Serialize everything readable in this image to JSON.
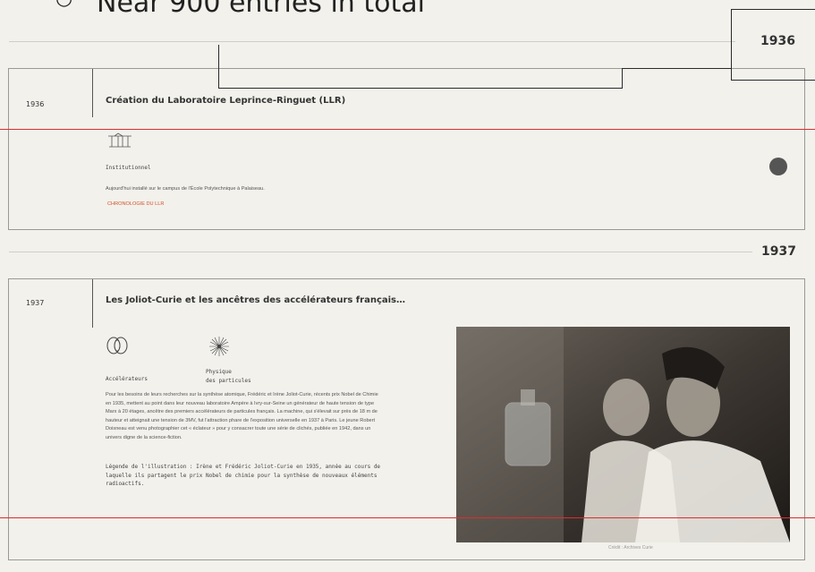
{
  "top_caption": {
    "bullet": "○",
    "text": "Near 900 entries in total"
  },
  "timeline": {
    "year_1936": {
      "header_year": "1936",
      "card": {
        "year": "1936",
        "title": "Création du Laboratoire Leprince-Ringuet (LLR)",
        "category": "Institutionnel",
        "description": "Aujourd'hui installé sur le campus de l'École Polytechnique à Palaiseau.",
        "link": "CHRONOLOGIE DU LLR"
      }
    },
    "year_1937": {
      "header_year": "1937",
      "card": {
        "year": "1937",
        "title": "Les Joliot-Curie et les ancêtres des accélérateurs français…",
        "category_1": "Accélérateurs",
        "category_2_line1": "Physique",
        "category_2_line2": "des particules",
        "body_lines": [
          "Pour les besoins de leurs recherches sur la synthèse atomique, Frédéric et Irène Joliot-Curie, récents prix Nobel de Chimie",
          "en 1935, mettent au point dans leur nouveau laboratoire Ampère à Ivry-sur-Seine un générateur de haute tension de type",
          "Marx à 20 étages, ancêtre des premiers accélérateurs de particules français. La machine, qui s'élevait sur près de 18 m de",
          "hauteur et atteignait une tension de 3MV, fut l'attraction phare de l'exposition universelle en 1937 à Paris. Le jeune Robert",
          "Doisneau est venu photographier cet « éclateur » pour y consacrer toute une série de clichés, publiée en 1942, dans un",
          "univers digne de la science-fiction."
        ],
        "legend_lines": [
          "Légende de l'illustration : Irène et Frédéric Joliot-Curie en 1935, année au cours de",
          "laquelle ils partagent le prix Nobel de chimie pour la synthèse de nouveaux éléments",
          "radioactifs."
        ],
        "photo_credit": "Crédit : Archives Curie"
      }
    }
  },
  "colors": {
    "accent_link": "#d2522a",
    "annotation_red": "#e32b2b",
    "background": "#f2f1ec"
  },
  "icons": {
    "institutional": "building-icon",
    "accelerators": "accelerator-icon",
    "particle_physics": "burst-icon"
  }
}
